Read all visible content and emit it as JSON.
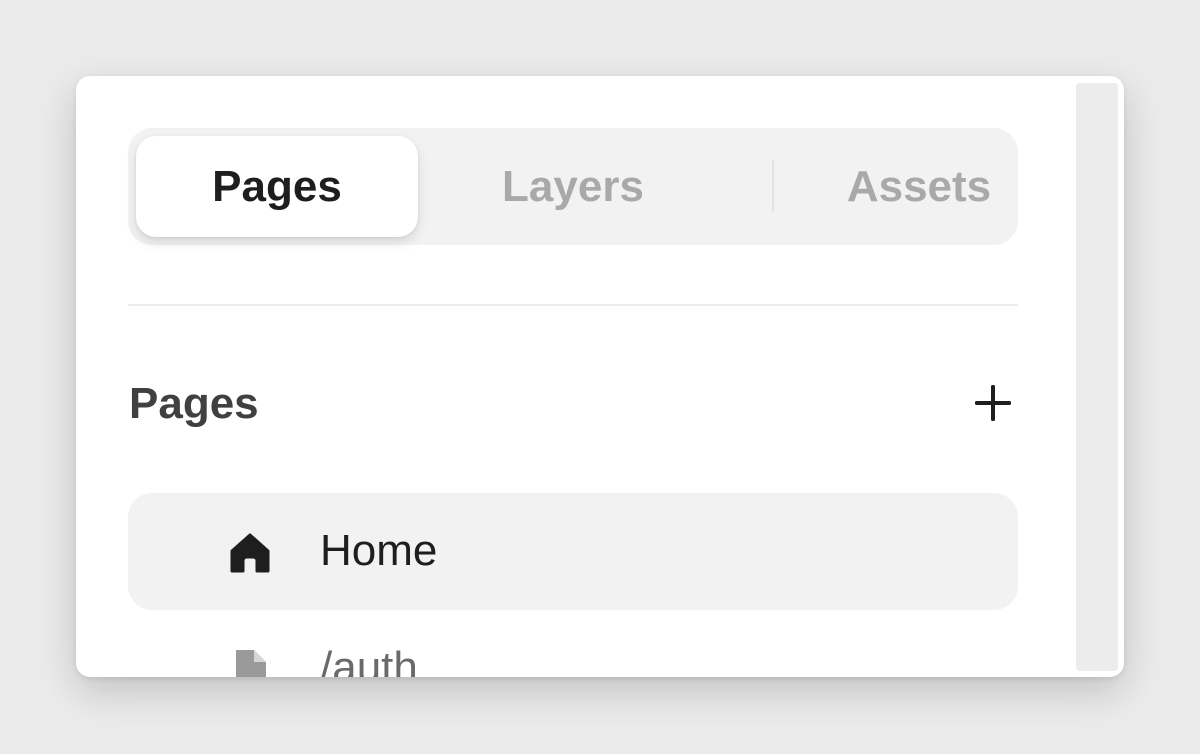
{
  "tabs": [
    {
      "label": "Pages",
      "active": true
    },
    {
      "label": "Layers",
      "active": false
    },
    {
      "label": "Assets",
      "active": false
    }
  ],
  "pages_section": {
    "title": "Pages",
    "add_icon": "plus-icon",
    "items": [
      {
        "label": "Home",
        "icon": "home-icon",
        "selected": true
      },
      {
        "label": "/auth",
        "icon": "file-icon",
        "selected": false
      }
    ]
  },
  "colors": {
    "active_text": "#1e1e1e",
    "inactive_text": "#a9a9a9",
    "selected_row_bg": "#f2f2f2"
  }
}
